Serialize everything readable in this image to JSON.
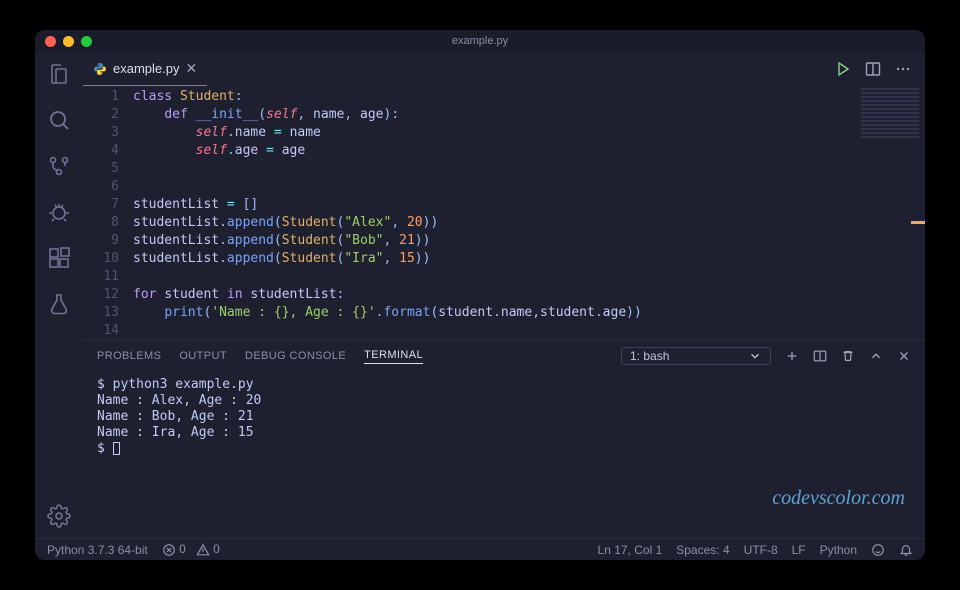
{
  "titlebar": {
    "title": "example.py"
  },
  "tab": {
    "filename": "example.py"
  },
  "code_lines": [
    "class Student:",
    "    def __init__(self, name, age):",
    "        self.name = name",
    "        self.age = age",
    "",
    "",
    "studentList = []",
    "studentList.append(Student(\"Alex\", 20))",
    "studentList.append(Student(\"Bob\", 21))",
    "studentList.append(Student(\"Ira\", 15))",
    "",
    "for student in studentList:",
    "    print('Name : {}, Age : {}'.format(student.name,student.age))",
    ""
  ],
  "line_numbers": [
    "1",
    "2",
    "3",
    "4",
    "5",
    "6",
    "7",
    "8",
    "9",
    "10",
    "11",
    "12",
    "13",
    "14"
  ],
  "panel": {
    "tabs": [
      "PROBLEMS",
      "OUTPUT",
      "DEBUG CONSOLE",
      "TERMINAL"
    ],
    "active": "TERMINAL",
    "terminal_selector": "1: bash"
  },
  "terminal_lines": [
    "$ python3 example.py",
    "Name : Alex, Age : 20",
    "Name : Bob, Age : 21",
    "Name : Ira, Age : 15",
    "$ "
  ],
  "status": {
    "interpreter": "Python 3.7.3 64-bit",
    "errors": "0",
    "warnings": "0",
    "lncol": "Ln 17, Col 1",
    "spaces": "Spaces: 4",
    "encoding": "UTF-8",
    "eol": "LF",
    "lang": "Python"
  },
  "watermark": "codevscolor.com"
}
